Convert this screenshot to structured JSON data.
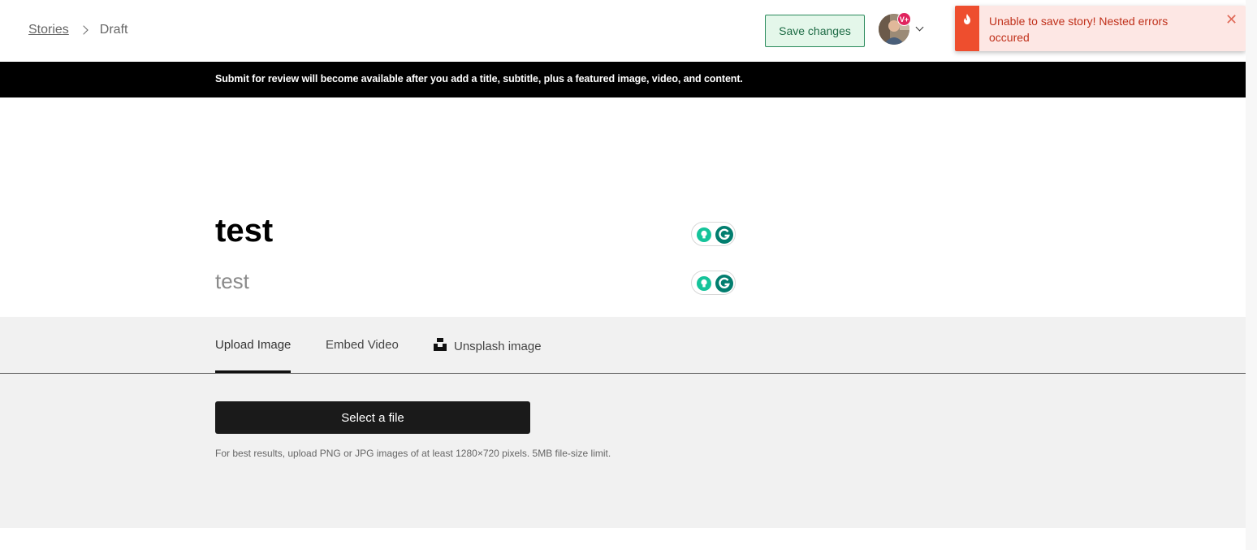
{
  "breadcrumb": {
    "parent": "Stories",
    "current": "Draft"
  },
  "header": {
    "save_label": "Save changes",
    "avatar_badge": "V+"
  },
  "toast": {
    "message": "Unable to save story! Nested errors occured",
    "close": "✕",
    "accent_color": "#ee4e2e"
  },
  "notice": {
    "text": "Submit for review will become available after you add a title, subtitle, plus a featured image, video, and content."
  },
  "story": {
    "title": "test",
    "subtitle": "test"
  },
  "media": {
    "tabs": [
      {
        "label": "Upload Image",
        "active": true
      },
      {
        "label": "Embed Video",
        "active": false
      },
      {
        "label": "Unsplash image",
        "active": false
      }
    ],
    "select_label": "Select a file",
    "hint": "For best results, upload PNG or JPG images of at least 1280×720 pixels. 5MB file-size limit."
  }
}
